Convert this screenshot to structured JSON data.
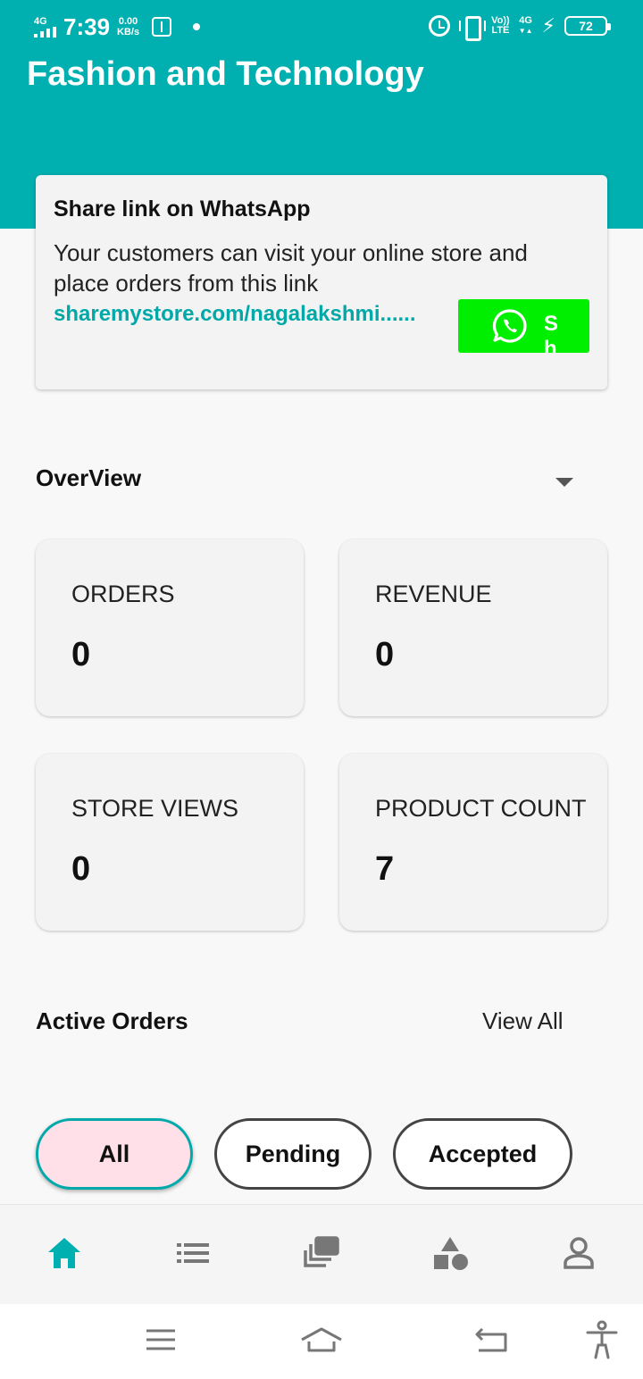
{
  "status_bar": {
    "network": "4G",
    "time": "7:39",
    "speed_value": "0.00",
    "speed_unit": "KB/s",
    "volte_top": "Vo))",
    "volte_bottom": "LTE",
    "net2": "4G",
    "battery": "72"
  },
  "header": {
    "title": "Fashion and Technology"
  },
  "share": {
    "title": "Share link on WhatsApp",
    "description": "Your customers can visit your online store and place orders from this link",
    "link": "sharemystore.com/nagalakshmi......",
    "button_label": "Sh"
  },
  "overview": {
    "title": "OverView",
    "cards": [
      {
        "label": "ORDERS",
        "value": "0"
      },
      {
        "label": "REVENUE",
        "value": "0"
      },
      {
        "label": "STORE VIEWS",
        "value": "0"
      },
      {
        "label": "PRODUCT COUNT",
        "value": "7"
      }
    ]
  },
  "active_orders": {
    "title": "Active Orders",
    "view_all": "View All",
    "filters": [
      "All",
      "Pending",
      "Accepted"
    ],
    "selected_filter": "All"
  },
  "bottom_nav": {
    "items": [
      "home-icon",
      "list-icon",
      "gallery-icon",
      "categories-icon",
      "profile-icon"
    ],
    "active": "home-icon",
    "active_color": "#00b0b0"
  },
  "system_nav": {
    "items": [
      "menu-icon",
      "home-outline-icon",
      "back-icon",
      "accessibility-icon"
    ]
  },
  "colors": {
    "header": "#00b0b0",
    "link": "#00a8a8",
    "whatsapp_button": "#00ee00",
    "chip_selected": "#ffdfe8"
  }
}
